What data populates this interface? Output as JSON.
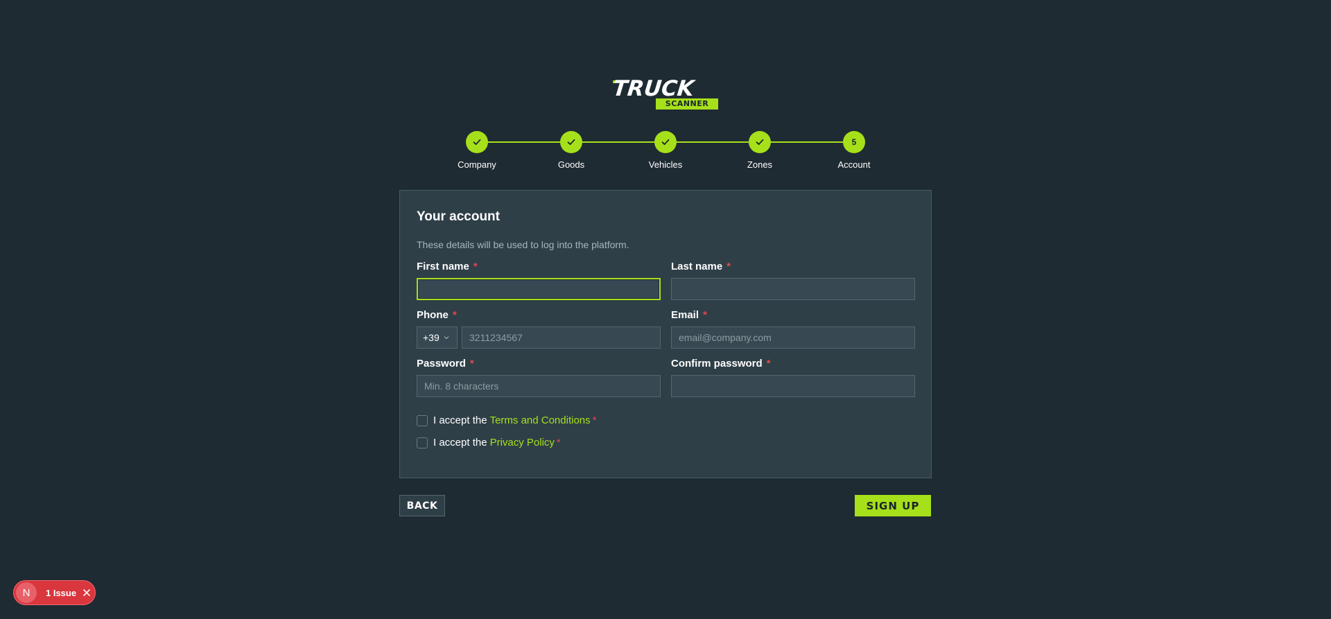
{
  "logo": {
    "main": "TRUCK",
    "sub": "SCANNER"
  },
  "stepper": {
    "steps": [
      {
        "label": "Company",
        "state": "done"
      },
      {
        "label": "Goods",
        "state": "done"
      },
      {
        "label": "Vehicles",
        "state": "done"
      },
      {
        "label": "Zones",
        "state": "done"
      },
      {
        "label": "Account",
        "state": "current",
        "number": "5"
      }
    ]
  },
  "card": {
    "title": "Your account",
    "description": "These details will be used to log into the platform.",
    "required_mark": "*",
    "fields": {
      "first_name": {
        "label": "First name",
        "value": "",
        "placeholder": ""
      },
      "last_name": {
        "label": "Last name",
        "value": "",
        "placeholder": ""
      },
      "phone": {
        "label": "Phone",
        "prefix": "+39",
        "value": "",
        "placeholder": "3211234567"
      },
      "email": {
        "label": "Email",
        "value": "",
        "placeholder": "email@company.com"
      },
      "password": {
        "label": "Password",
        "value": "",
        "placeholder": "Min. 8 characters"
      },
      "confirm_password": {
        "label": "Confirm password",
        "value": "",
        "placeholder": ""
      }
    },
    "terms": {
      "prefix": "I accept the",
      "link": "Terms and Conditions"
    },
    "privacy": {
      "prefix": "I accept the",
      "link": "Privacy Policy"
    }
  },
  "actions": {
    "back": "BACK",
    "signup": "SIGN UP"
  },
  "dev_overlay": {
    "avatar": "N",
    "issues": "1 Issue"
  },
  "colors": {
    "background": "#1f2b33",
    "card": "#2f3f48",
    "accent": "#a6e01a",
    "required": "#e5484d",
    "issue": "#d9363e"
  }
}
